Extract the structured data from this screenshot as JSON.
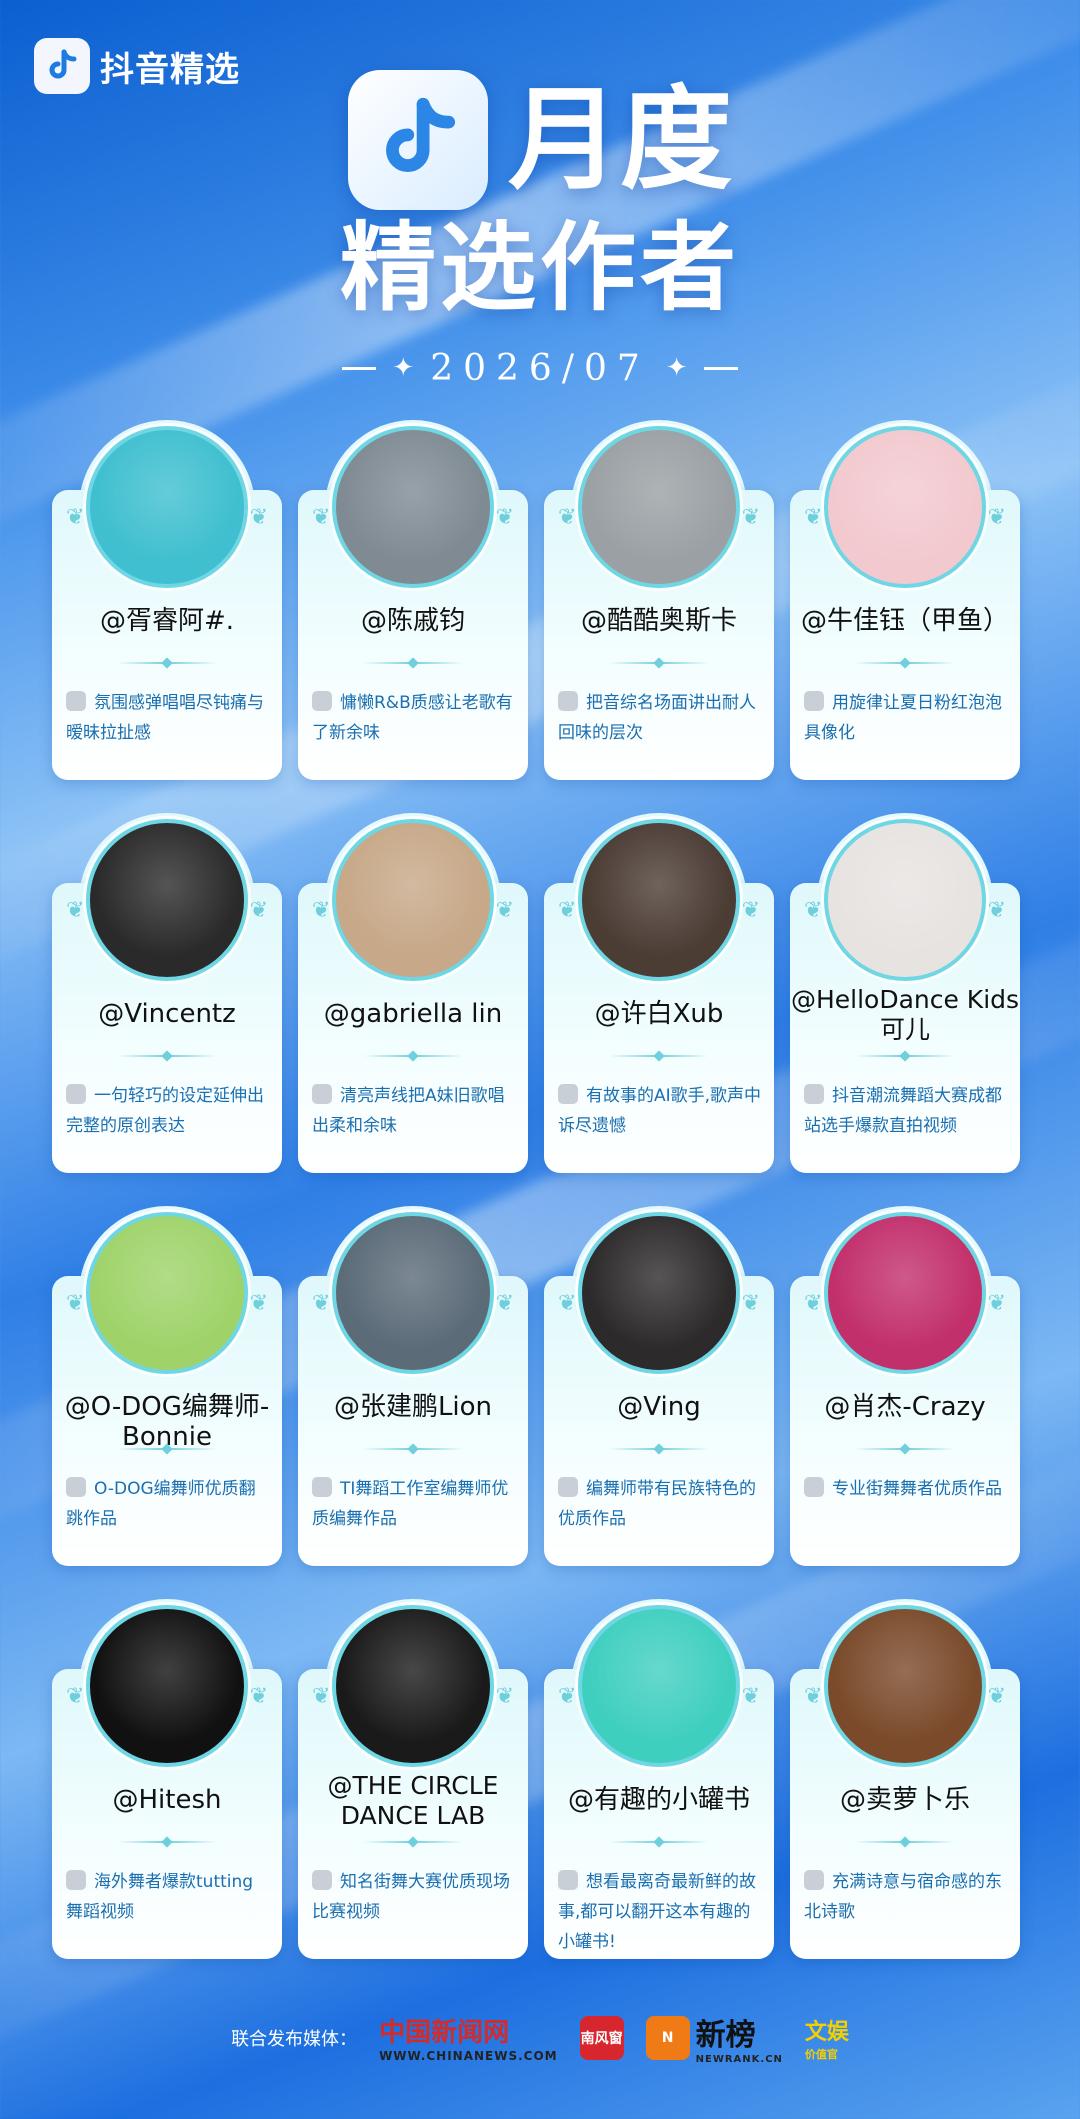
{
  "brand": {
    "name": "抖音精选"
  },
  "hero": {
    "title_line1": "月度",
    "title_line2": "精选作者",
    "date": "2026/07"
  },
  "creators": [
    {
      "handle": "@胥睿阿#.",
      "desc": "氛围感弹唱唱尽钝痛与暧昧拉扯感",
      "avatar_bg": "#3fbfcf"
    },
    {
      "handle": "@陈戚钧",
      "desc": "慵懒R&B质感让老歌有了新余味",
      "avatar_bg": "#7f8a93"
    },
    {
      "handle": "@酷酷奥斯卡",
      "desc": "把音综名场面讲出耐人回味的层次",
      "avatar_bg": "#9aa0a4"
    },
    {
      "handle": "@牛佳钰（甲鱼）",
      "desc": "用旋律让夏日粉红泡泡具像化",
      "avatar_bg": "#f2c9cf"
    },
    {
      "handle": "@Vincentz",
      "desc": "一句轻巧的设定延伸出完整的原创表达",
      "avatar_bg": "#2a2a2a"
    },
    {
      "handle": "@gabriella lin",
      "desc": "清亮声线把A妹旧歌唱出柔和余味",
      "avatar_bg": "#c7a888"
    },
    {
      "handle": "@许白Xub",
      "desc": "有故事的AI歌手,歌声中诉尽遗憾",
      "avatar_bg": "#4b3c34"
    },
    {
      "handle": "@HelloDance Kids可儿",
      "desc": "抖音潮流舞蹈大赛成都站选手爆款直拍视频",
      "avatar_bg": "#e7e3e1"
    },
    {
      "handle": "@O-DOG编舞师-Bonnie",
      "desc": "O-DOG编舞师优质翻跳作品",
      "avatar_bg": "#9fd36a"
    },
    {
      "handle": "@张建鹏Lion",
      "desc": "TI舞蹈工作室编舞师优质编舞作品",
      "avatar_bg": "#5b6b78"
    },
    {
      "handle": "@Ving",
      "desc": "编舞师带有民族特色的优质作品",
      "avatar_bg": "#2d2a2c"
    },
    {
      "handle": "@肖杰-Crazy",
      "desc": "专业街舞舞者优质作品",
      "avatar_bg": "#c2306b"
    },
    {
      "handle": "@Hitesh",
      "desc": "海外舞者爆款tutting舞蹈视频",
      "avatar_bg": "#111111"
    },
    {
      "handle": "@THE CIRCLE DANCE LAB",
      "desc": "知名街舞大赛优质现场比赛视频",
      "avatar_bg": "#1a1a1a"
    },
    {
      "handle": "@有趣的小罐书",
      "desc": "想看最离奇最新鲜的故事,都可以翻开这本有趣的小罐书!",
      "avatar_bg": "#3fcfbf"
    },
    {
      "handle": "@卖萝卜乐",
      "desc": "充满诗意与宿命感的东北诗歌",
      "avatar_bg": "#7a4a2a"
    }
  ],
  "footer": {
    "label": "联合发布媒体：",
    "media": [
      {
        "name": "中国新闻网",
        "sub": "WWW.CHINANEWS.COM"
      },
      {
        "name": "南风窗"
      },
      {
        "name": "新榜",
        "sub": "NEWRANK.CN"
      },
      {
        "name": "文娱",
        "sub": "价值官"
      }
    ]
  }
}
